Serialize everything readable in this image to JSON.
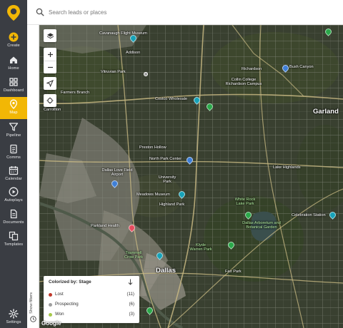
{
  "brand": {
    "accent": "#f2b705",
    "sidebar_bg": "#3a3d43",
    "logo_icon": "map-pin-logo-icon"
  },
  "sidebar": {
    "items": [
      {
        "label": "Create",
        "icon": "plus-circle-icon"
      },
      {
        "label": "Home",
        "icon": "home-icon"
      },
      {
        "label": "Dashboard",
        "icon": "dashboard-grid-icon"
      },
      {
        "label": "Map",
        "icon": "map-pin-icon",
        "active": true
      },
      {
        "label": "Pipeline",
        "icon": "funnel-icon"
      },
      {
        "label": "Comms",
        "icon": "document-icon"
      },
      {
        "label": "Calendar",
        "icon": "calendar-icon"
      },
      {
        "label": "Autoplays",
        "icon": "play-circle-icon"
      },
      {
        "label": "Documents",
        "icon": "documents-icon"
      },
      {
        "label": "Templates",
        "icon": "templates-icon"
      },
      {
        "label": "Settings",
        "icon": "gear-icon"
      }
    ]
  },
  "search": {
    "placeholder": "Search leads or places",
    "value": ""
  },
  "filters": {
    "label": "Show filters"
  },
  "map": {
    "city_labels": [
      "Cavanaugh Flight Museum",
      "Addison",
      "Vitruvian Park",
      "Farmers Branch",
      "Carrollton",
      "Richardson",
      "Collin College Richardson Campus",
      "Bush Canyon",
      "Garland",
      "Costco Wholesale",
      "North Park Center",
      "University Park",
      "Dallas Love Field Airport",
      "Preston Hollow",
      "Lake Highlands",
      "Meadows Museum",
      "Highland Park",
      "White Rock Lake Park",
      "Dallas Arboretum and Botanical Garden",
      "Celebration Station",
      "Parkland Health",
      "Trammell Crow Park",
      "Klyde Warren Park",
      "Dallas",
      "Fair Park"
    ],
    "attribution": "Google"
  },
  "legend": {
    "title": "Colorized by: Stage",
    "sort_icon": "arrow-down-icon",
    "rows": [
      {
        "label": "Lost",
        "count": "(11)",
        "color": "#c0392b"
      },
      {
        "label": "Prospecting",
        "count": "(6)",
        "color": "#9e9e9e"
      },
      {
        "label": "Won",
        "count": "(3)",
        "color": "#a6c94a"
      }
    ]
  }
}
